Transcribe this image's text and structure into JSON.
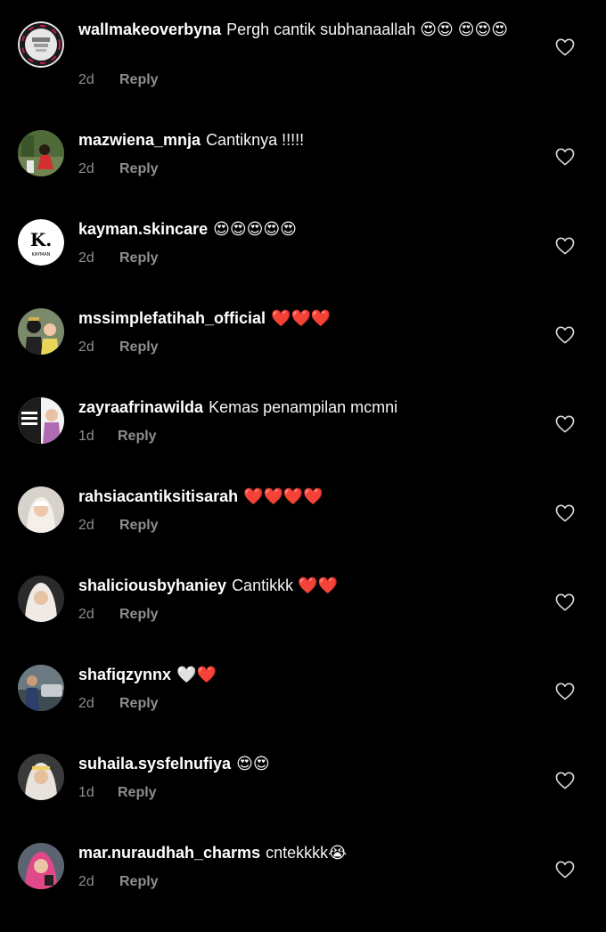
{
  "comments": [
    {
      "username": "wallmakeoverbyna",
      "text": "Pergh cantik subhanaallah 😍😍 😍😍😍",
      "time": "2d",
      "reply_label": "Reply"
    },
    {
      "username": "mazwiena_mnja",
      "text": "Cantiknya !!!!!",
      "time": "2d",
      "reply_label": "Reply"
    },
    {
      "username": "kayman.skincare",
      "text": "😍😍😍😍😍",
      "time": "2d",
      "reply_label": "Reply"
    },
    {
      "username": "mssimplefatihah_official",
      "text": "❤️❤️❤️",
      "time": "2d",
      "reply_label": "Reply"
    },
    {
      "username": "zayraafrinawilda",
      "text": "Kemas penampilan mcmni",
      "time": "1d",
      "reply_label": "Reply"
    },
    {
      "username": "rahsiacantiksitisarah",
      "text": "❤️❤️❤️❤️",
      "time": "2d",
      "reply_label": "Reply"
    },
    {
      "username": "shaliciousbyhaniey",
      "text": "Cantikkk ❤️❤️",
      "time": "2d",
      "reply_label": "Reply"
    },
    {
      "username": "shafiqzynnx",
      "text": "🤍❤️",
      "time": "2d",
      "reply_label": "Reply"
    },
    {
      "username": "suhaila.sysfelnufiya",
      "text": "😍😍",
      "time": "1d",
      "reply_label": "Reply"
    },
    {
      "username": "mar.nuraudhah_charms",
      "text": "cntekkkk😭",
      "time": "2d",
      "reply_label": "Reply"
    }
  ],
  "avatars": {
    "kayman_letter": "K.",
    "kayman_brand": "KAYMAN"
  },
  "colors": {
    "background": "#000000",
    "username": "#ffffff",
    "meta": "#8e8e8e",
    "heart_outline": "#d9d9d9"
  }
}
